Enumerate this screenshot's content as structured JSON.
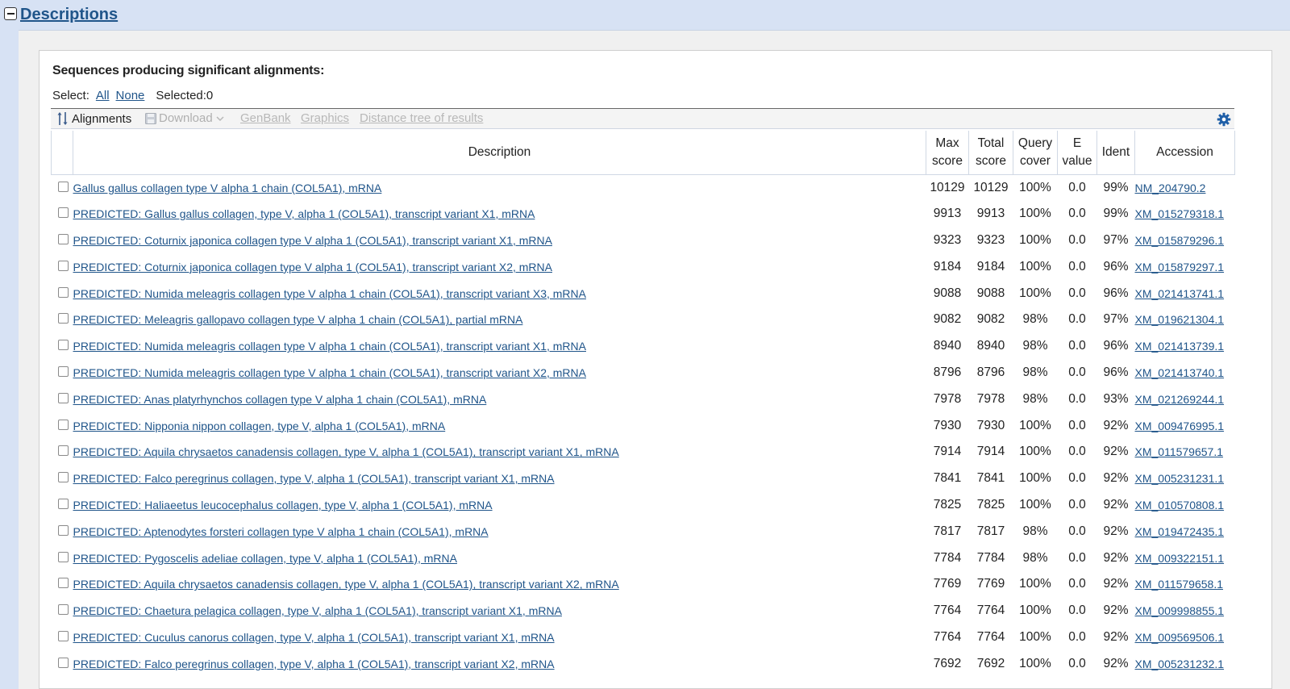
{
  "header": {
    "title": "Descriptions"
  },
  "section_title": "Sequences producing significant alignments:",
  "select": {
    "label": "Select:",
    "all": "All",
    "none": "None",
    "selected": "Selected:0"
  },
  "toolbar": {
    "alignments": "Alignments",
    "download": "Download",
    "genbank": "GenBank",
    "graphics": "Graphics",
    "distance_tree": "Distance tree of results"
  },
  "columns": {
    "description": "Description",
    "max_score": [
      "Max",
      "score"
    ],
    "total_score": [
      "Total",
      "score"
    ],
    "query_cover": [
      "Query",
      "cover"
    ],
    "e_value": [
      "E",
      "value"
    ],
    "ident": "Ident",
    "accession": "Accession"
  },
  "rows": [
    {
      "description": "Gallus gallus collagen type V alpha 1 chain (COL5A1), mRNA",
      "max": "10129",
      "total": "10129",
      "cover": "100%",
      "evalue": "0.0",
      "ident": "99%",
      "accession": "NM_204790.2"
    },
    {
      "description": "PREDICTED: Gallus gallus collagen, type V, alpha 1 (COL5A1), transcript variant X1, mRNA",
      "max": "9913",
      "total": "9913",
      "cover": "100%",
      "evalue": "0.0",
      "ident": "99%",
      "accession": "XM_015279318.1"
    },
    {
      "description": "PREDICTED: Coturnix japonica collagen type V alpha 1 (COL5A1), transcript variant X1, mRNA",
      "max": "9323",
      "total": "9323",
      "cover": "100%",
      "evalue": "0.0",
      "ident": "97%",
      "accession": "XM_015879296.1"
    },
    {
      "description": "PREDICTED: Coturnix japonica collagen type V alpha 1 (COL5A1), transcript variant X2, mRNA",
      "max": "9184",
      "total": "9184",
      "cover": "100%",
      "evalue": "0.0",
      "ident": "96%",
      "accession": "XM_015879297.1"
    },
    {
      "description": "PREDICTED: Numida meleagris collagen type V alpha 1 chain (COL5A1), transcript variant X3, mRNA",
      "max": "9088",
      "total": "9088",
      "cover": "100%",
      "evalue": "0.0",
      "ident": "96%",
      "accession": "XM_021413741.1"
    },
    {
      "description": "PREDICTED: Meleagris gallopavo collagen type V alpha 1 chain (COL5A1), partial mRNA",
      "max": "9082",
      "total": "9082",
      "cover": "98%",
      "evalue": "0.0",
      "ident": "97%",
      "accession": "XM_019621304.1"
    },
    {
      "description": "PREDICTED: Numida meleagris collagen type V alpha 1 chain (COL5A1), transcript variant X1, mRNA",
      "max": "8940",
      "total": "8940",
      "cover": "98%",
      "evalue": "0.0",
      "ident": "96%",
      "accession": "XM_021413739.1"
    },
    {
      "description": "PREDICTED: Numida meleagris collagen type V alpha 1 chain (COL5A1), transcript variant X2, mRNA",
      "max": "8796",
      "total": "8796",
      "cover": "98%",
      "evalue": "0.0",
      "ident": "96%",
      "accession": "XM_021413740.1"
    },
    {
      "description": "PREDICTED: Anas platyrhynchos collagen type V alpha 1 chain (COL5A1), mRNA",
      "max": "7978",
      "total": "7978",
      "cover": "98%",
      "evalue": "0.0",
      "ident": "93%",
      "accession": "XM_021269244.1"
    },
    {
      "description": "PREDICTED: Nipponia nippon collagen, type V, alpha 1 (COL5A1), mRNA",
      "max": "7930",
      "total": "7930",
      "cover": "100%",
      "evalue": "0.0",
      "ident": "92%",
      "accession": "XM_009476995.1"
    },
    {
      "description": "PREDICTED: Aquila chrysaetos canadensis collagen, type V, alpha 1 (COL5A1), transcript variant X1, mRNA",
      "max": "7914",
      "total": "7914",
      "cover": "100%",
      "evalue": "0.0",
      "ident": "92%",
      "accession": "XM_011579657.1"
    },
    {
      "description": "PREDICTED: Falco peregrinus collagen, type V, alpha 1 (COL5A1), transcript variant X1, mRNA",
      "max": "7841",
      "total": "7841",
      "cover": "100%",
      "evalue": "0.0",
      "ident": "92%",
      "accession": "XM_005231231.1"
    },
    {
      "description": "PREDICTED: Haliaeetus leucocephalus collagen, type V, alpha 1 (COL5A1), mRNA",
      "max": "7825",
      "total": "7825",
      "cover": "100%",
      "evalue": "0.0",
      "ident": "92%",
      "accession": "XM_010570808.1"
    },
    {
      "description": "PREDICTED: Aptenodytes forsteri collagen type V alpha 1 chain (COL5A1), mRNA",
      "max": "7817",
      "total": "7817",
      "cover": "98%",
      "evalue": "0.0",
      "ident": "92%",
      "accession": "XM_019472435.1"
    },
    {
      "description": "PREDICTED: Pygoscelis adeliae collagen, type V, alpha 1 (COL5A1), mRNA",
      "max": "7784",
      "total": "7784",
      "cover": "98%",
      "evalue": "0.0",
      "ident": "92%",
      "accession": "XM_009322151.1"
    },
    {
      "description": "PREDICTED: Aquila chrysaetos canadensis collagen, type V, alpha 1 (COL5A1), transcript variant X2, mRNA",
      "max": "7769",
      "total": "7769",
      "cover": "100%",
      "evalue": "0.0",
      "ident": "92%",
      "accession": "XM_011579658.1"
    },
    {
      "description": "PREDICTED: Chaetura pelagica collagen, type V, alpha 1 (COL5A1), transcript variant X1, mRNA",
      "max": "7764",
      "total": "7764",
      "cover": "100%",
      "evalue": "0.0",
      "ident": "92%",
      "accession": "XM_009998855.1"
    },
    {
      "description": "PREDICTED: Cuculus canorus collagen, type V, alpha 1 (COL5A1), transcript variant X1, mRNA",
      "max": "7764",
      "total": "7764",
      "cover": "100%",
      "evalue": "0.0",
      "ident": "92%",
      "accession": "XM_009569506.1"
    },
    {
      "description": "PREDICTED: Falco peregrinus collagen, type V, alpha 1 (COL5A1), transcript variant X2, mRNA",
      "max": "7692",
      "total": "7692",
      "cover": "100%",
      "evalue": "0.0",
      "ident": "92%",
      "accession": "XM_005231232.1"
    }
  ],
  "colors": {
    "link": "#20558a",
    "header_bg": "#d7e2f4",
    "disabled": "#b8b8b8",
    "gear": "#1f5fa8"
  },
  "icons": {
    "toggle": "collapse-minus-icon",
    "alignments": "sort-arrows-icon",
    "download": "floppy-disk-icon",
    "settings": "gear-icon"
  }
}
